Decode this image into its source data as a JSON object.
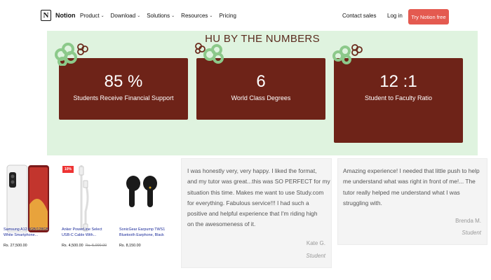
{
  "nav": {
    "brand": "Notion",
    "logo_letter": "N",
    "links": [
      "Product",
      "Download",
      "Solutions",
      "Resources",
      "Pricing"
    ],
    "contact": "Contact sales",
    "login": "Log in",
    "cta": "Try Notion free",
    "cta_color": "#e45a50"
  },
  "hu": {
    "title": "HU BY THE NUMBERS",
    "stats": [
      {
        "value": "85 %",
        "label": "Students Receive Financial Support"
      },
      {
        "value": "6",
        "label": "World Class Degrees"
      },
      {
        "value": "12 :1",
        "label": "Student to Faculty Ratio"
      }
    ],
    "background": "#dff3df",
    "card_color": "#6e2318"
  },
  "products": [
    {
      "name_line1": "Samsung A12 4GB/128GB",
      "name_line2": "White Smartphone...",
      "price": "Rs. 27,500.00",
      "old_price": ""
    },
    {
      "name_line1": "Anker PowerLine Select",
      "name_line2": "USB-C Cable With...",
      "price": "Rs. 4,500.00",
      "old_price": "Rs. 5,000.00",
      "badge": "10%"
    },
    {
      "name_line1": "SonicGear Earpump TWS1",
      "name_line2": "Bluetooth Earphone, Black",
      "price": "Rs. 8,150.00",
      "old_price": ""
    }
  ],
  "reviews": [
    {
      "lines": [
        "I was honestly very, very happy. I liked the format,",
        "and my tutor was great...this was SO PERFECT for my",
        "situation this time. Makes me want to use Study.com",
        "for everything. Fabulous service!!! I had such a",
        "positive and helpful experience that I'm riding high",
        "on the awesomeness of it."
      ],
      "name": "Kate G.",
      "role": "Student"
    },
    {
      "lines": [
        "Amazing experience! I needed that little push to help",
        "me understand what was right in front of me!... The",
        "tutor really helped me understand what I was",
        "struggling with."
      ],
      "name": "Brenda M.",
      "role": "Student"
    }
  ]
}
